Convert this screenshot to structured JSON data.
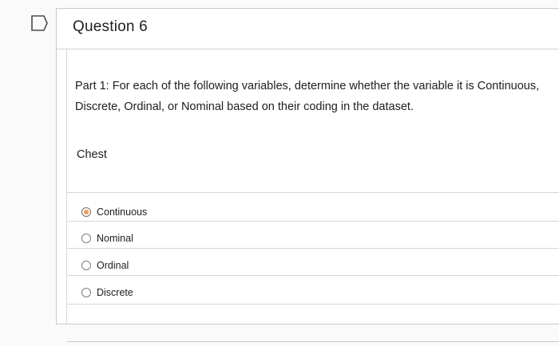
{
  "question": {
    "title": "Question 6",
    "prompt": "Part 1: For each of the following variables, determine whether the variable it is Continuous, Discrete, Ordinal, or Nominal based on their coding in the dataset.",
    "variable": "Chest",
    "selected_option": "Continuous",
    "options": [
      {
        "label": "Continuous",
        "selected": true
      },
      {
        "label": "Nominal",
        "selected": false
      },
      {
        "label": "Ordinal",
        "selected": false
      },
      {
        "label": "Discrete",
        "selected": false
      }
    ]
  },
  "icons": {
    "bookmark": "bookmark-outline-icon"
  },
  "colors": {
    "selected_radio": "#f29a52",
    "border": "#c9c9c9"
  }
}
